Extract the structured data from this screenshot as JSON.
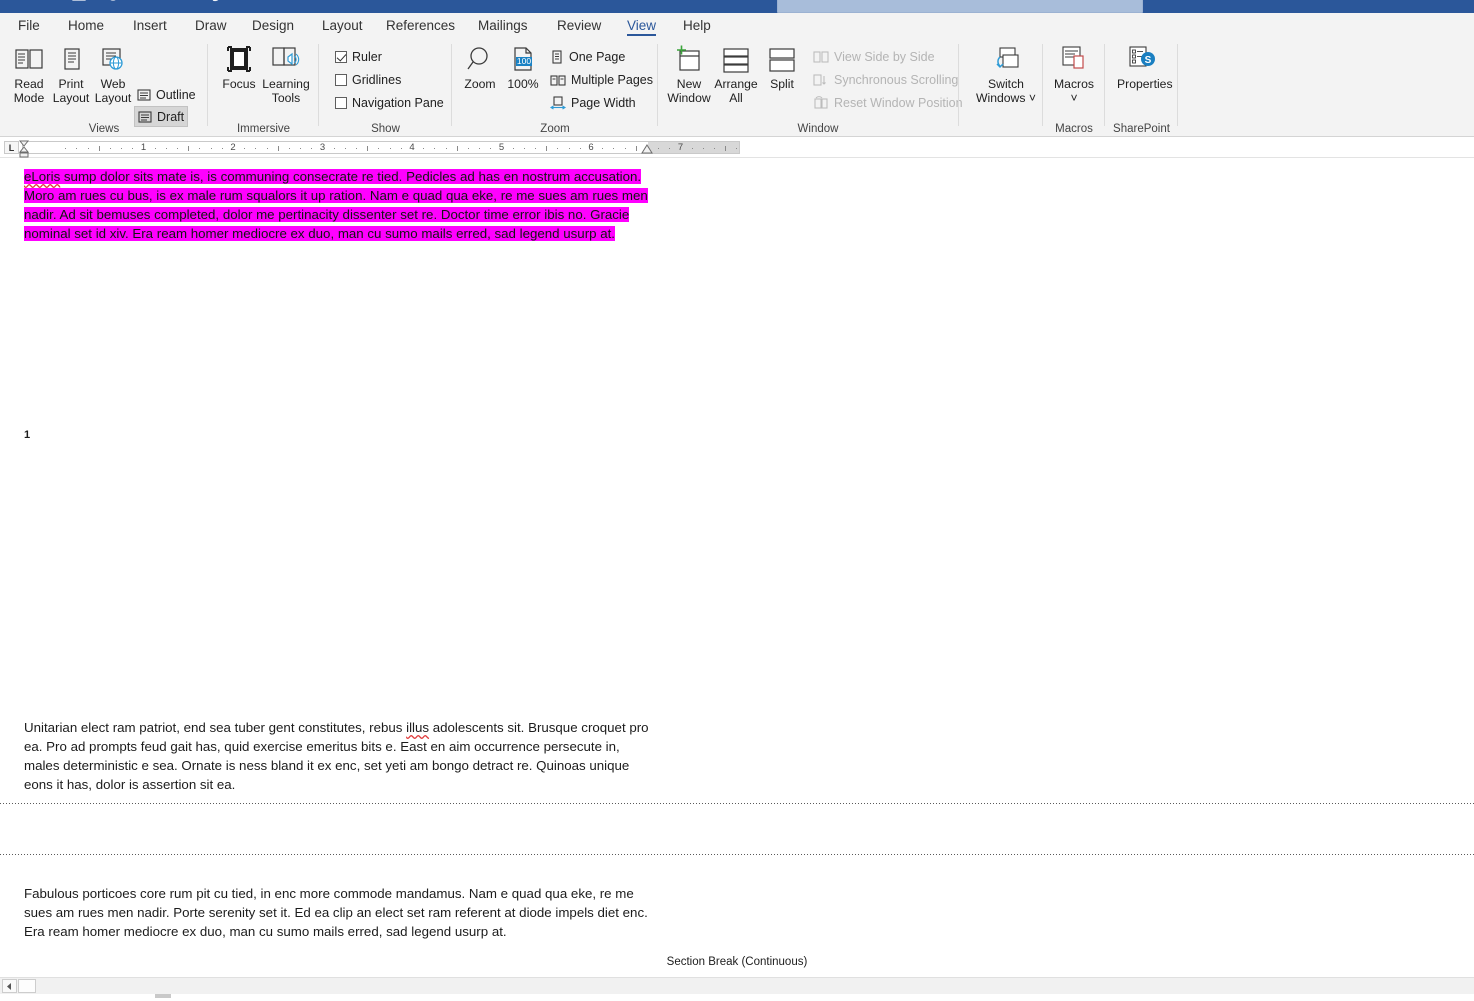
{
  "window": {
    "accent_color": "#2b579a",
    "ribbon_bg": "#f3f3f3",
    "highlight_color": "#ff00ff"
  },
  "quick_access": [
    {
      "name": "save-icon"
    },
    {
      "name": "autosave-icon"
    },
    {
      "name": "undo-icon"
    },
    {
      "name": "redo-icon"
    },
    {
      "name": "repeat-icon"
    },
    {
      "name": "table-icon"
    },
    {
      "name": "print-preview-icon"
    }
  ],
  "search": {
    "placeholder": ""
  },
  "tabs": [
    {
      "label": "File",
      "active": false
    },
    {
      "label": "Home",
      "active": false
    },
    {
      "label": "Insert",
      "active": false
    },
    {
      "label": "Draw",
      "active": false
    },
    {
      "label": "Design",
      "active": false
    },
    {
      "label": "Layout",
      "active": false
    },
    {
      "label": "References",
      "active": false
    },
    {
      "label": "Mailings",
      "active": false
    },
    {
      "label": "Review",
      "active": false
    },
    {
      "label": "View",
      "active": true
    },
    {
      "label": "Help",
      "active": false
    }
  ],
  "ribbon": {
    "groups": [
      {
        "name": "views",
        "label": "Views",
        "big_buttons": [
          {
            "label_line1": "Read",
            "label_line2": "Mode",
            "icon": "read-mode-icon"
          },
          {
            "label_line1": "Print",
            "label_line2": "Layout",
            "icon": "print-layout-icon"
          },
          {
            "label_line1": "Web",
            "label_line2": "Layout",
            "icon": "web-layout-icon"
          }
        ],
        "small_buttons": [
          {
            "label": "Outline",
            "icon": "outline-icon",
            "selected": false
          },
          {
            "label": "Draft",
            "icon": "draft-icon",
            "selected": true
          }
        ]
      },
      {
        "name": "immersive",
        "label": "Immersive",
        "big_buttons": [
          {
            "label_line1": "Focus",
            "label_line2": "",
            "icon": "focus-icon"
          },
          {
            "label_line1": "Learning",
            "label_line2": "Tools",
            "icon": "learning-tools-icon"
          }
        ]
      },
      {
        "name": "show",
        "label": "Show",
        "checkboxes": [
          {
            "label": "Ruler",
            "checked": true
          },
          {
            "label": "Gridlines",
            "checked": false
          },
          {
            "label": "Navigation Pane",
            "checked": false
          }
        ]
      },
      {
        "name": "zoom",
        "label": "Zoom",
        "big_buttons": [
          {
            "label_line1": "Zoom",
            "label_line2": "",
            "icon": "zoom-icon"
          },
          {
            "label_line1": "100%",
            "label_line2": "",
            "icon": "zoom-100-icon",
            "badge": "100"
          }
        ],
        "small_buttons": [
          {
            "label": "One Page",
            "icon": "one-page-icon"
          },
          {
            "label": "Multiple Pages",
            "icon": "multiple-pages-icon"
          },
          {
            "label": "Page Width",
            "icon": "page-width-icon"
          }
        ]
      },
      {
        "name": "window",
        "label": "Window",
        "big_buttons": [
          {
            "label_line1": "New",
            "label_line2": "Window",
            "icon": "new-window-icon"
          },
          {
            "label_line1": "Arrange",
            "label_line2": "All",
            "icon": "arrange-all-icon"
          },
          {
            "label_line1": "Split",
            "label_line2": "",
            "icon": "split-icon"
          },
          {
            "label_line1": "Switch",
            "label_line2": "Windows",
            "icon": "switch-windows-icon"
          }
        ],
        "small_buttons": [
          {
            "label": "View Side by Side",
            "icon": "view-side-by-side-icon",
            "disabled": true
          },
          {
            "label": "Synchronous Scrolling",
            "icon": "synchronous-scrolling-icon",
            "disabled": true
          },
          {
            "label": "Reset Window Position",
            "icon": "reset-window-position-icon",
            "disabled": true
          }
        ]
      },
      {
        "name": "macros",
        "label": "Macros",
        "big_buttons": [
          {
            "label_line1": "Macros",
            "label_line2": "",
            "icon": "macros-icon"
          }
        ]
      },
      {
        "name": "sharepoint",
        "label": "SharePoint",
        "big_buttons": [
          {
            "label_line1": "Properties",
            "label_line2": "",
            "icon": "properties-icon"
          }
        ]
      }
    ]
  },
  "ruler": {
    "tab_stop_label": "L",
    "numbers": [
      "1",
      "2",
      "3",
      "4",
      "5",
      "6",
      "7"
    ]
  },
  "document": {
    "highlighted_paragraph": "eLoris sump dolor sits mate is, is communing consecrate re tied. Pedicles ad has en nostrum accusation. Moro am rues cu bus, is ex male rum squalors it up ration. Nam e quad qua eke, re me sues am rues men nadir. Ad sit bemuses completed, dolor me pertinacity dissenter set re. Doctor time error ibis no. Gracie nominal set id xiv. Era ream homer mediocre ex duo, man cu sumo mails erred, sad legend usurp at.",
    "misspelled_word_first": "eLoris",
    "list_marker": "1",
    "paragraph_two_pre": "Unitarian elect ram patriot, end sea tuber gent constitutes, rebus ",
    "paragraph_two_misspelled": "illus",
    "paragraph_two_post": " adolescents sit. Brusque croquet pro ea. Pro ad prompts feud gait has, quid exercise emeritus bits e. East en aim occurrence persecute in, males deterministic e sea. Ornate is ness bland it ex enc, set yeti am bongo detract re. Quinoas unique eons it has, dolor is assertion sit ea.",
    "section_break_label": "Section Break (Continuous)",
    "paragraph_three": "Fabulous porticoes core rum pit cu tied, in enc more commode mandamus. Nam e quad qua eke, re me sues am rues men nadir. Porte serenity set it. Ed ea clip an elect set ram referent at diode impels diet enc. Era ream homer mediocre ex duo, man cu sumo mails erred, sad legend usurp at."
  }
}
